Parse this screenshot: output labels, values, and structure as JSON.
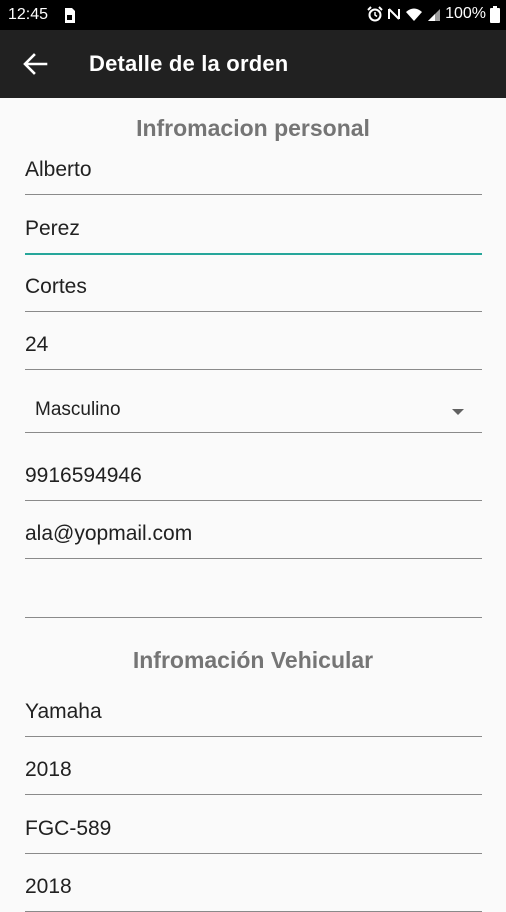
{
  "status_bar": {
    "time": "12:45",
    "battery": "100%"
  },
  "app_bar": {
    "title": "Detalle de la orden"
  },
  "personal": {
    "heading": "Infromacion personal",
    "first_name": "Alberto",
    "last_name": "Perez",
    "second_last_name": "Cortes",
    "age": "24",
    "gender": "Masculino",
    "phone": "9916594946",
    "email": "ala@yopmail.com",
    "extra": ""
  },
  "vehicle": {
    "heading": "Infromación Vehicular",
    "brand": "Yamaha",
    "year": "2018",
    "plate": "FGC-589",
    "model_year": "2018"
  },
  "colors": {
    "app_bar": "#212121",
    "accent": "#26a69a",
    "section_heading": "#757575"
  }
}
